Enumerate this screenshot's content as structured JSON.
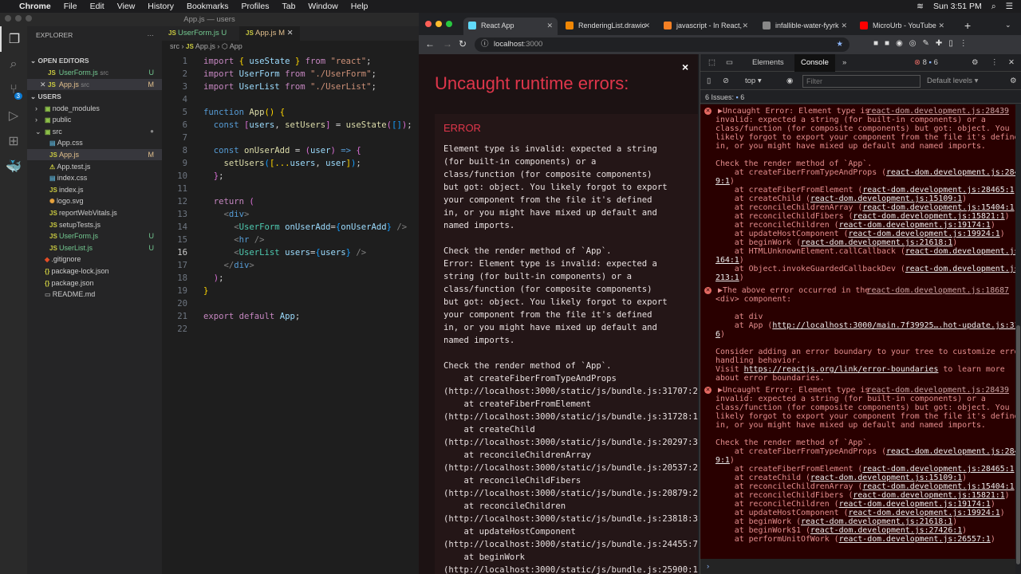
{
  "menubar": {
    "app": "Chrome",
    "items": [
      "File",
      "Edit",
      "View",
      "History",
      "Bookmarks",
      "Profiles",
      "Tab",
      "Window",
      "Help"
    ],
    "clock": "Sun 3:51 PM"
  },
  "vscode": {
    "title": "App.js — users",
    "scm_badge": "3",
    "explorer": "EXPLORER",
    "more": "···",
    "open_editors": "OPEN EDITORS",
    "open": [
      {
        "name": "UserForm.js",
        "dir": "src",
        "status": "U"
      },
      {
        "name": "App.js",
        "dir": "src",
        "status": "M"
      }
    ],
    "project": "USERS",
    "tree": [
      {
        "name": "node_modules",
        "kind": "folder",
        "indent": 1
      },
      {
        "name": "public",
        "kind": "folder",
        "indent": 1
      },
      {
        "name": "src",
        "kind": "folder-open",
        "indent": 1,
        "status": "●"
      },
      {
        "name": "App.css",
        "kind": "css",
        "indent": 2
      },
      {
        "name": "App.js",
        "kind": "js",
        "indent": 2,
        "status": "M",
        "sel": true
      },
      {
        "name": "App.test.js",
        "kind": "test",
        "indent": 2
      },
      {
        "name": "index.css",
        "kind": "css",
        "indent": 2
      },
      {
        "name": "index.js",
        "kind": "js",
        "indent": 2
      },
      {
        "name": "logo.svg",
        "kind": "svg",
        "indent": 2
      },
      {
        "name": "reportWebVitals.js",
        "kind": "js",
        "indent": 2
      },
      {
        "name": "setupTests.js",
        "kind": "js",
        "indent": 2
      },
      {
        "name": "UserForm.js",
        "kind": "js",
        "indent": 2,
        "status": "U"
      },
      {
        "name": "UserList.js",
        "kind": "js",
        "indent": 2,
        "status": "U"
      },
      {
        "name": ".gitignore",
        "kind": "git",
        "indent": 1
      },
      {
        "name": "package-lock.json",
        "kind": "json",
        "indent": 1
      },
      {
        "name": "package.json",
        "kind": "json",
        "indent": 1
      },
      {
        "name": "README.md",
        "kind": "md",
        "indent": 1
      }
    ],
    "tabs": [
      {
        "name": "UserForm.js",
        "status": "U"
      },
      {
        "name": "App.js",
        "status": "M",
        "close": "✕"
      }
    ],
    "breadcrumb": [
      "src",
      "App.js",
      "App"
    ],
    "current_line": 16,
    "code": [
      [
        [
          "import ",
          "kw"
        ],
        [
          "{ ",
          "b"
        ],
        [
          "useState",
          "v"
        ],
        [
          " } ",
          "b"
        ],
        [
          "from ",
          "kw"
        ],
        [
          "\"react\"",
          "s"
        ],
        [
          ";",
          "p"
        ]
      ],
      [
        [
          "import ",
          "kw"
        ],
        [
          "UserForm ",
          "v"
        ],
        [
          "from ",
          "kw"
        ],
        [
          "\"./UserForm\"",
          "s"
        ],
        [
          ";",
          "p"
        ]
      ],
      [
        [
          "import ",
          "kw"
        ],
        [
          "UserList ",
          "v"
        ],
        [
          "from ",
          "kw"
        ],
        [
          "\"./UserList\"",
          "s"
        ],
        [
          ";",
          "p"
        ]
      ],
      [],
      [
        [
          "function ",
          "k2"
        ],
        [
          "App",
          "f"
        ],
        [
          "() ",
          "b"
        ],
        [
          "{",
          "b"
        ]
      ],
      [
        [
          "  const ",
          "k2"
        ],
        [
          "[",
          "b2"
        ],
        [
          "users",
          "v"
        ],
        [
          ", ",
          "p"
        ],
        [
          "setUsers",
          "f"
        ],
        [
          "] ",
          "b2"
        ],
        [
          "= ",
          "p"
        ],
        [
          "useState",
          "f"
        ],
        [
          "(",
          "b2"
        ],
        [
          "[]",
          "b3"
        ],
        [
          ")",
          "b2"
        ],
        [
          ";",
          "p"
        ]
      ],
      [],
      [
        [
          "  const ",
          "k2"
        ],
        [
          "onUserAdd ",
          "f"
        ],
        [
          "= ",
          "p"
        ],
        [
          "(",
          "b2"
        ],
        [
          "user",
          "v"
        ],
        [
          ") ",
          "b2"
        ],
        [
          "=> ",
          "k2"
        ],
        [
          "{",
          "b2"
        ]
      ],
      [
        [
          "    setUsers",
          "f"
        ],
        [
          "(",
          "b3"
        ],
        [
          "[...",
          "b"
        ],
        [
          "users",
          "v"
        ],
        [
          ", ",
          "p"
        ],
        [
          "user",
          "v"
        ],
        [
          "]",
          "b"
        ],
        [
          ")",
          "b3"
        ],
        [
          ";",
          "p"
        ]
      ],
      [
        [
          "  }",
          "b2"
        ],
        [
          ";",
          "p"
        ]
      ],
      [],
      [
        [
          "  return ",
          "kw"
        ],
        [
          "(",
          "b2"
        ]
      ],
      [
        [
          "    <",
          "tg"
        ],
        [
          "div",
          "k2"
        ],
        [
          ">",
          "tg"
        ]
      ],
      [
        [
          "      <",
          "tg"
        ],
        [
          "UserForm ",
          "t"
        ],
        [
          "onUserAdd",
          "v"
        ],
        [
          "=",
          "p"
        ],
        [
          "{",
          "b3"
        ],
        [
          "onUserAdd",
          "v"
        ],
        [
          "} ",
          "b3"
        ],
        [
          "/>",
          "tg"
        ]
      ],
      [
        [
          "      <",
          "tg"
        ],
        [
          "hr ",
          "k2"
        ],
        [
          "/>",
          "tg"
        ]
      ],
      [
        [
          "      <",
          "tg"
        ],
        [
          "UserList ",
          "t"
        ],
        [
          "users",
          "v"
        ],
        [
          "=",
          "p"
        ],
        [
          "{",
          "b3"
        ],
        [
          "users",
          "v"
        ],
        [
          "} ",
          "b3"
        ],
        [
          "/>",
          "tg"
        ]
      ],
      [
        [
          "    </",
          "tg"
        ],
        [
          "div",
          "k2"
        ],
        [
          ">",
          "tg"
        ]
      ],
      [
        [
          "  )",
          "b2"
        ],
        [
          ";",
          "p"
        ]
      ],
      [
        [
          "}",
          "b"
        ]
      ],
      [],
      [
        [
          "export ",
          "kw"
        ],
        [
          "default ",
          "kw"
        ],
        [
          "App",
          "v"
        ],
        [
          ";",
          "p"
        ]
      ],
      []
    ]
  },
  "chrome": {
    "tabs": [
      {
        "title": "React App",
        "color": "#61dafb",
        "active": true
      },
      {
        "title": "RenderingList.drawio",
        "color": "#f08705"
      },
      {
        "title": "javascript - In React,",
        "color": "#f48024"
      },
      {
        "title": "infallible-water-fyyrk",
        "color": "#888888"
      },
      {
        "title": "MicroUrb - YouTube",
        "color": "#ff0000"
      }
    ],
    "new_tab": "+",
    "url_host": "localhost",
    "url_port": ":3000",
    "overlay": {
      "title": "Uncaught runtime errors:",
      "close": "×",
      "label": "ERROR",
      "lines": [
        "Element type is invalid: expected a string",
        "(for built-in components) or a",
        "class/function (for composite components)",
        "but got: object. You likely forgot to export",
        "your component from the file it's defined",
        "in, or you might have mixed up default and",
        "named imports.",
        "",
        "Check the render method of `App`.",
        "Error: Element type is invalid: expected a",
        "string (for built-in components) or a",
        "class/function (for composite components)",
        "but got: object. You likely forgot to export",
        "your component from the file it's defined",
        "in, or you might have mixed up default and",
        "named imports.",
        "",
        "Check the render method of `App`.",
        "    at createFiberFromTypeAndProps",
        "(http://localhost:3000/static/js/bundle.js:31707:2",
        "    at createFiberFromElement",
        "(http://localhost:3000/static/js/bundle.js:31728:1",
        "    at createChild",
        "(http://localhost:3000/static/js/bundle.js:20297:3",
        "    at reconcileChildrenArray",
        "(http://localhost:3000/static/js/bundle.js:20537:2",
        "    at reconcileChildFibers",
        "(http://localhost:3000/static/js/bundle.js:20879:2",
        "    at reconcileChildren",
        "(http://localhost:3000/static/js/bundle.js:23818:3",
        "    at updateHostComponent",
        "(http://localhost:3000/static/js/bundle.js:24455:7",
        "    at beginWork",
        "(http://localhost:3000/static/js/bundle.js:25900:1"
      ]
    },
    "devtools": {
      "tabs": [
        "Elements",
        "Console"
      ],
      "more": "»",
      "errors": "8",
      "warnings": "6",
      "context": "top",
      "filter_placeholder": "Filter",
      "levels": "Default levels",
      "issues_label": "6 Issues:",
      "issues_count": "6",
      "messages": [
        {
          "source": "react-dom.development.js:28439",
          "lines": [
            [
              "▶Uncaught Error: Element type is",
              "",
              ""
            ],
            [
              "invalid: expected a string (for built-in components) or a",
              "",
              ""
            ],
            [
              "class/function (for composite components) but got: object. You",
              "",
              ""
            ],
            [
              "likely forgot to export your component from the file it's defined",
              "",
              ""
            ],
            [
              "in, or you might have mixed up default and named imports.",
              "",
              ""
            ],
            [
              "",
              "",
              ""
            ],
            [
              "Check the render method of `App`.",
              "",
              ""
            ],
            [
              "    at createFiberFromTypeAndProps (",
              "react-dom.development.js:2843",
              ""
            ],
            [
              "",
              "9:1",
              ")"
            ],
            [
              "    at createFiberFromElement (",
              "react-dom.development.js:28465:1",
              ")"
            ],
            [
              "    at createChild (",
              "react-dom.development.js:15109:1",
              ")"
            ],
            [
              "    at reconcileChildrenArray (",
              "react-dom.development.js:15404:1",
              ")"
            ],
            [
              "    at reconcileChildFibers (",
              "react-dom.development.js:15821:1",
              ")"
            ],
            [
              "    at reconcileChildren (",
              "react-dom.development.js:19174:1",
              ")"
            ],
            [
              "    at updateHostComponent (",
              "react-dom.development.js:19924:1",
              ")"
            ],
            [
              "    at beginWork (",
              "react-dom.development.js:21618:1",
              ")"
            ],
            [
              "    at HTMLUnknownElement.callCallback (",
              "react-dom.development.js:4",
              ""
            ],
            [
              "",
              "164:1",
              ")"
            ],
            [
              "    at Object.invokeGuardedCallbackDev (",
              "react-dom.development.js:4",
              ""
            ],
            [
              "",
              "213:1",
              ")"
            ]
          ]
        },
        {
          "source": "react-dom.development.js:18687",
          "lines": [
            [
              "▶The above error occurred in the",
              "",
              ""
            ],
            [
              "<div> component:",
              "",
              ""
            ],
            [
              "",
              "",
              ""
            ],
            [
              "    at div",
              "",
              ""
            ],
            [
              "    at App (",
              "http://localhost:3000/main.7f39925….hot-update.js:31:7",
              ""
            ],
            [
              "",
              "6",
              ")"
            ],
            [
              "",
              "",
              ""
            ],
            [
              "Consider adding an error boundary to your tree to customize error",
              "",
              ""
            ],
            [
              "handling behavior.",
              "",
              ""
            ],
            [
              "Visit ",
              "https://reactjs.org/link/error-boundaries",
              " to learn more"
            ],
            [
              "about error boundaries.",
              "",
              ""
            ]
          ]
        },
        {
          "source": "react-dom.development.js:28439",
          "lines": [
            [
              "▶Uncaught Error: Element type is",
              "",
              ""
            ],
            [
              "invalid: expected a string (for built-in components) or a",
              "",
              ""
            ],
            [
              "class/function (for composite components) but got: object. You",
              "",
              ""
            ],
            [
              "likely forgot to export your component from the file it's defined",
              "",
              ""
            ],
            [
              "in, or you might have mixed up default and named imports.",
              "",
              ""
            ],
            [
              "",
              "",
              ""
            ],
            [
              "Check the render method of `App`.",
              "",
              ""
            ],
            [
              "    at createFiberFromTypeAndProps (",
              "react-dom.development.js:2843",
              ""
            ],
            [
              "",
              "9:1",
              ")"
            ],
            [
              "    at createFiberFromElement (",
              "react-dom.development.js:28465:1",
              ")"
            ],
            [
              "    at createChild (",
              "react-dom.development.js:15109:1",
              ")"
            ],
            [
              "    at reconcileChildrenArray (",
              "react-dom.development.js:15404:1",
              ")"
            ],
            [
              "    at reconcileChildFibers (",
              "react-dom.development.js:15821:1",
              ")"
            ],
            [
              "    at reconcileChildren (",
              "react-dom.development.js:19174:1",
              ")"
            ],
            [
              "    at updateHostComponent (",
              "react-dom.development.js:19924:1",
              ")"
            ],
            [
              "    at beginWork (",
              "react-dom.development.js:21618:1",
              ")"
            ],
            [
              "    at beginWork$1 (",
              "react-dom.development.js:27426:1",
              ")"
            ],
            [
              "    at performUnitOfWork (",
              "react-dom.development.js:26557:1",
              ")"
            ]
          ]
        }
      ],
      "prompt": "›"
    }
  }
}
